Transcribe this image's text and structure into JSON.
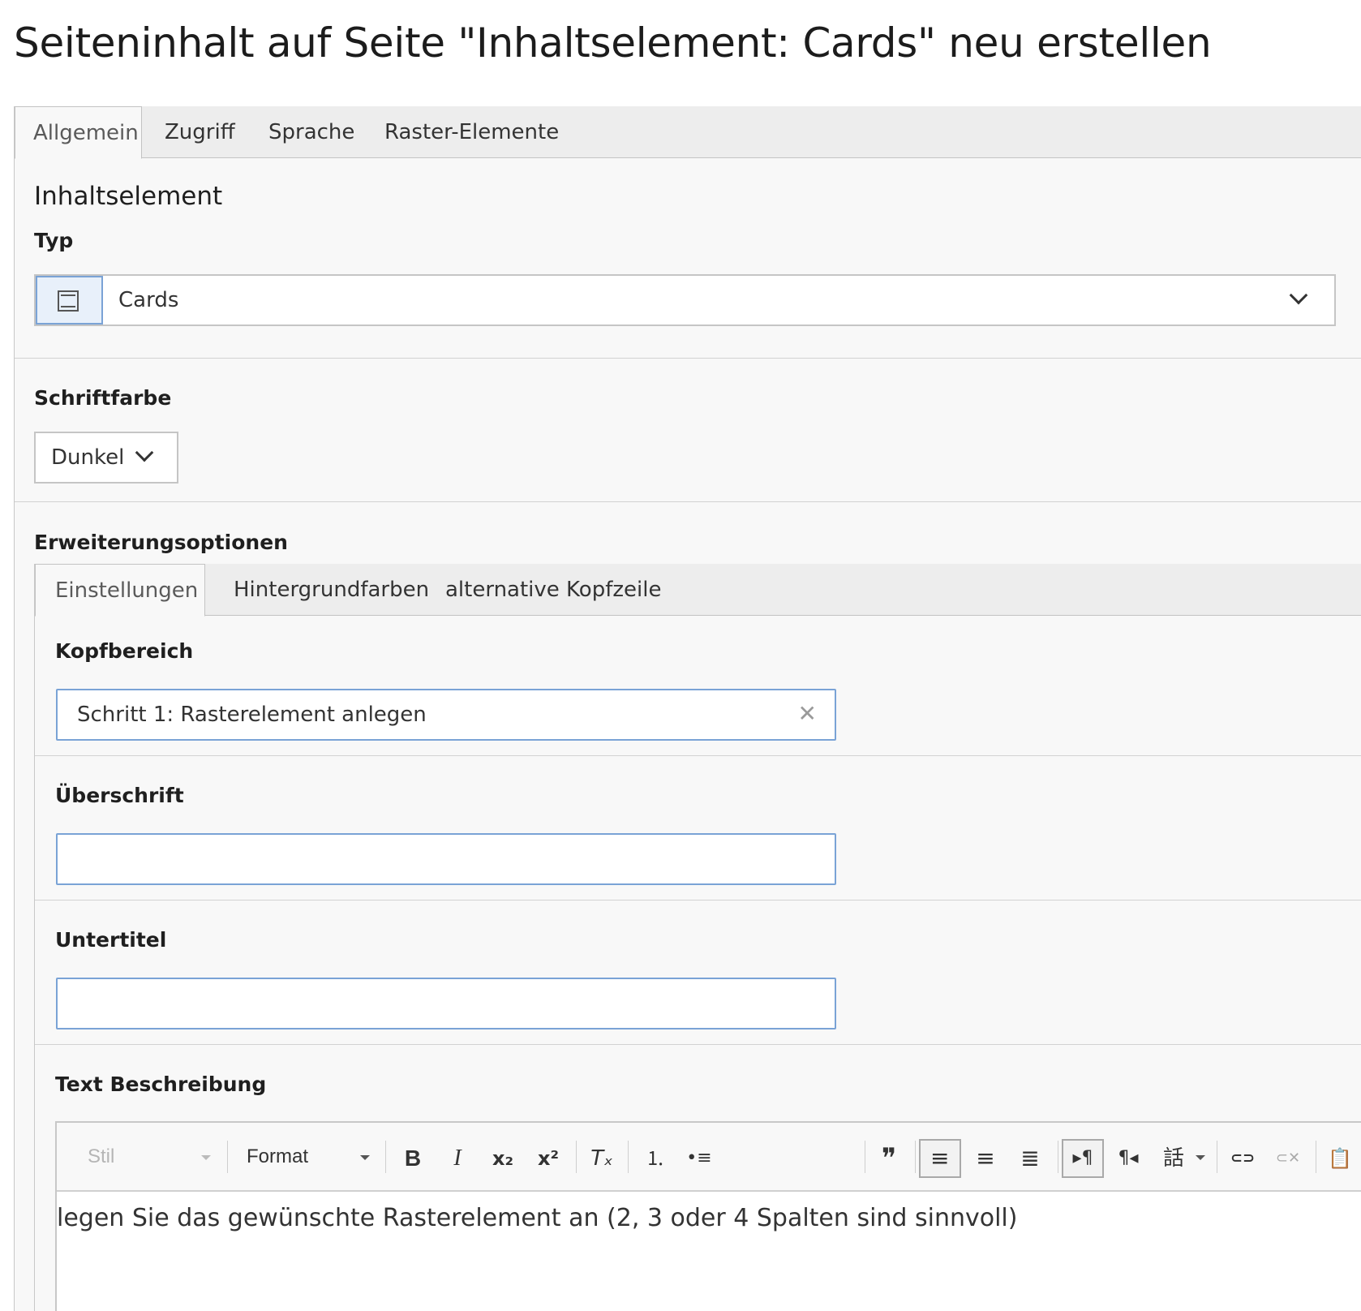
{
  "page": {
    "title": "Seiteninhalt auf Seite \"Inhaltselement: Cards\" neu erstellen"
  },
  "main_tabs": [
    "Allgemein",
    "Zugriff",
    "Sprache",
    "Raster-Elemente"
  ],
  "content_element": {
    "section_title": "Inhaltselement",
    "type_label": "Typ",
    "type_value": "Cards",
    "type_icon": "content-element-icon"
  },
  "font_color": {
    "label": "Schriftfarbe",
    "value": "Dunkel"
  },
  "extension": {
    "label": "Erweiterungsoptionen",
    "tabs": [
      "Einstellungen",
      "Hintergrundfarben",
      "alternative Kopfzeile"
    ],
    "header_area": {
      "label": "Kopfbereich",
      "value": "Schritt 1: Rasterelement anlegen"
    },
    "heading": {
      "label": "Überschrift",
      "value": ""
    },
    "subtitle": {
      "label": "Untertitel",
      "value": ""
    },
    "text": {
      "label": "Text Beschreibung",
      "toolbar": {
        "style_combo": "Stil",
        "format_combo": "Format",
        "buttons": [
          {
            "name": "bold-icon",
            "glyph": "B"
          },
          {
            "name": "italic-icon",
            "glyph": "I"
          },
          {
            "name": "subscript-icon",
            "glyph": "x₂"
          },
          {
            "name": "superscript-icon",
            "glyph": "x²"
          },
          {
            "name": "remove-format-icon",
            "glyph": "Tₓ"
          },
          {
            "name": "numbered-list-icon",
            "glyph": "⒈"
          },
          {
            "name": "bulleted-list-icon",
            "glyph": "•≡"
          },
          {
            "name": "blockquote-icon",
            "glyph": "❞"
          },
          {
            "name": "align-left-icon",
            "glyph": "≡"
          },
          {
            "name": "align-center-icon",
            "glyph": "≡"
          },
          {
            "name": "justify-icon",
            "glyph": "≣"
          },
          {
            "name": "ltr-icon",
            "glyph": "▸¶"
          },
          {
            "name": "rtl-icon",
            "glyph": "¶◂"
          },
          {
            "name": "language-icon",
            "glyph": "話"
          },
          {
            "name": "link-icon",
            "glyph": "⊂⊃"
          },
          {
            "name": "unlink-icon",
            "glyph": "⊂✕"
          },
          {
            "name": "paste-icon",
            "glyph": "📋"
          }
        ]
      },
      "content": "legen Sie das gewünschte Rasterelement an (2, 3 oder 4 Spalten sind sinnvoll)"
    }
  },
  "colors": {
    "accent_blue": "#7aa3d6",
    "tab_bg": "#ededed",
    "panel_bg": "#f8f8f8"
  }
}
